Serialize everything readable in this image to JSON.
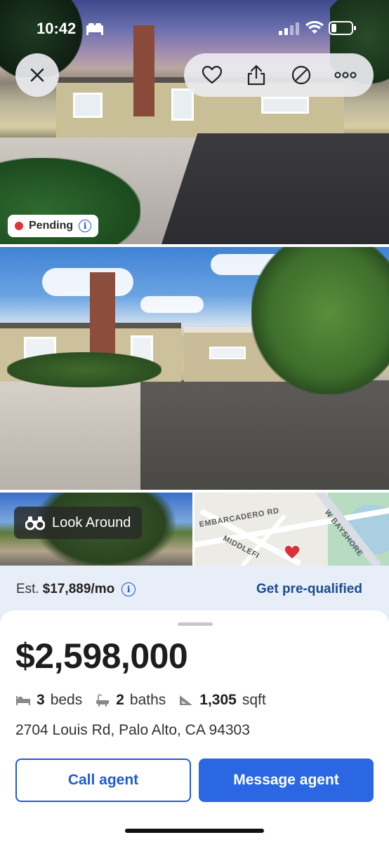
{
  "status_bar": {
    "time": "10:42"
  },
  "listing": {
    "status": "Pending",
    "price": "$2,598,000",
    "beds_value": "3",
    "beds_label": "beds",
    "baths_value": "2",
    "baths_label": "baths",
    "sqft_value": "1,305",
    "sqft_label": "sqft",
    "address": "2704 Louis Rd, Palo Alto, CA 94303"
  },
  "estimate": {
    "prefix": "Est.",
    "amount": "$17,889/mo",
    "prequal_label": "Get pre-qualified"
  },
  "media": {
    "look_around_label": "Look Around",
    "map_labels": {
      "embarcadero": "EMBARCADERO RD",
      "middlefield": "MIDDLEFI",
      "bayshore": "W BAYSHORE"
    }
  },
  "actions": {
    "call_label": "Call agent",
    "message_label": "Message agent"
  },
  "colors": {
    "brand_blue": "#2b67e2",
    "pending_red": "#e0333c",
    "link_blue": "#1a4d8f"
  },
  "icons": [
    "close-icon",
    "heart-icon",
    "share-icon",
    "block-icon",
    "more-icon",
    "info-icon",
    "binoculars-icon",
    "bed-icon",
    "bath-icon",
    "sqft-icon",
    "map-pin-icon",
    "wifi-icon",
    "battery-icon",
    "signal-icon",
    "bed-status-icon"
  ]
}
